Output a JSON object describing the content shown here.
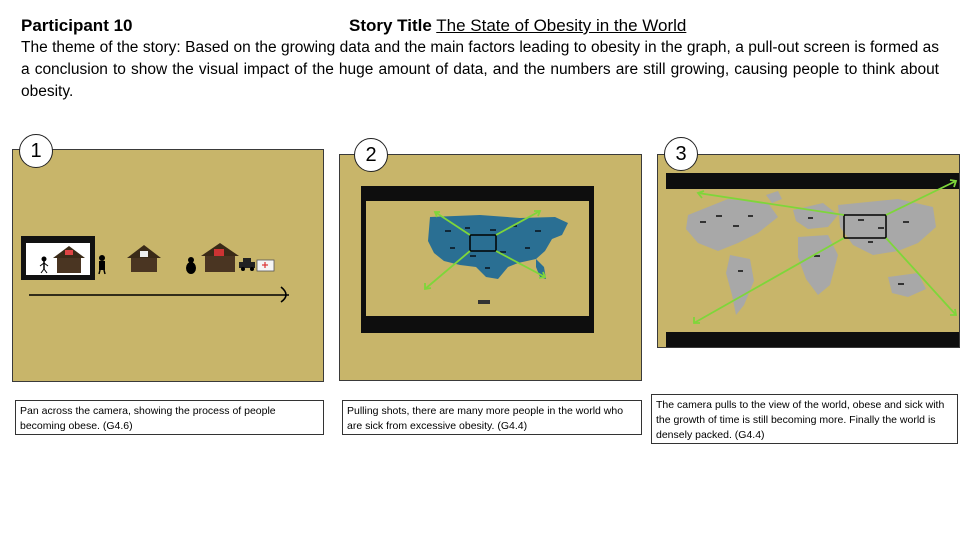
{
  "header": {
    "participant": "Participant 10",
    "story_label": "Story Title",
    "story_title": "The State of Obesity in the World",
    "theme": "The theme of the story: Based on the growing data and the main factors leading to obesity in the graph, a pull-out screen is formed as a conclusion to show the visual impact of the huge amount of data, and the numbers are still growing, causing people to think about obesity."
  },
  "panels": [
    {
      "number": "1",
      "caption": "Pan across the camera, showing the process of people becoming obese. (G4.6)"
    },
    {
      "number": "2",
      "caption": "Pulling shots, there are many more people in the world who are sick from excessive obesity. (G4.4)"
    },
    {
      "number": "3",
      "caption": "The camera pulls to the view of the world, obese and sick with the growth of time is still becoming more. Finally the world is densely packed. (G4.4)"
    }
  ],
  "colors": {
    "panel_bg": "#c8b56a",
    "map_blue": "#2a6f93",
    "map_gray": "#a8a8a8",
    "arrow_green": "#7ed63a"
  }
}
